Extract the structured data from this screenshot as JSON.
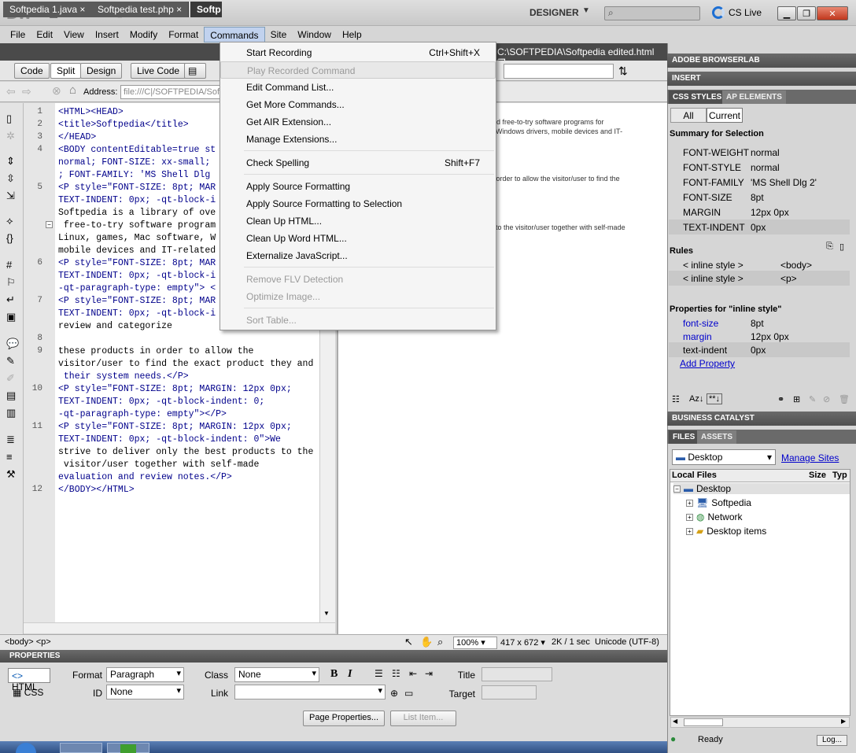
{
  "app": {
    "logo": "Dw",
    "workspace": "DESIGNER",
    "cslive": "CS Live",
    "window_buttons": [
      "▁",
      "❐",
      "✕"
    ]
  },
  "menubar": [
    "File",
    "Edit",
    "View",
    "Insert",
    "Modify",
    "Format",
    "Commands",
    "Site",
    "Window",
    "Help"
  ],
  "doc_tabs": [
    "Softpedia 1.java",
    "Softpedia test.php",
    "Softp"
  ],
  "doc_path": "C:\\SOFTPEDIA\\Softpedia edited.html",
  "view_buttons": {
    "code": "Code",
    "split": "Split",
    "design": "Design",
    "live_code": "Live Code"
  },
  "address": {
    "label": "Address:",
    "value": "file:///C|/SOFTPEDIA/Sof"
  },
  "code_lines": [
    {
      "n": "1",
      "t": "<HTML><HEAD>",
      "k": "tag"
    },
    {
      "n": "2",
      "t": "<title>Softpedia</title>",
      "k": "tag"
    },
    {
      "n": "3",
      "t": "</HEAD>",
      "k": "tag"
    },
    {
      "n": "4",
      "t": "<BODY contentEditable=true st",
      "k": "tag"
    },
    {
      "n": "",
      "t": "normal; FONT-SIZE: xx-small;",
      "k": "tag"
    },
    {
      "n": "",
      "t": "; FONT-FAMILY: 'MS Shell Dlg",
      "k": "tag"
    },
    {
      "n": "5",
      "t": "<P style=\"FONT-SIZE: 8pt; MAR",
      "k": "tag"
    },
    {
      "n": "",
      "t": "TEXT-INDENT: 0px; -qt-block-i",
      "k": "tag"
    },
    {
      "n": "",
      "t": "Softpedia is a library of ove",
      "k": "txt"
    },
    {
      "n": "",
      "t": " free-to-try software program",
      "k": "txt"
    },
    {
      "n": "",
      "t": "Linux, games, Mac software, W",
      "k": "txt"
    },
    {
      "n": "",
      "t": "mobile devices and IT-related",
      "k": "txt"
    },
    {
      "n": "6",
      "t": "<P style=\"FONT-SIZE: 8pt; MAR",
      "k": "tag"
    },
    {
      "n": "",
      "t": "TEXT-INDENT: 0px; -qt-block-i",
      "k": "tag"
    },
    {
      "n": "",
      "t": "-qt-paragraph-type: empty\"> <",
      "k": "tag"
    },
    {
      "n": "7",
      "t": "<P style=\"FONT-SIZE: 8pt; MAR",
      "k": "tag"
    },
    {
      "n": "",
      "t": "TEXT-INDENT: 0px; -qt-block-i",
      "k": "tag"
    },
    {
      "n": "",
      "t": "review and categorize",
      "k": "txt"
    },
    {
      "n": "8",
      "t": "",
      "k": "txt"
    },
    {
      "n": "9",
      "t": "these products in order to allow the",
      "k": "txt"
    },
    {
      "n": "",
      "t": "visitor/user to find the exact product they and",
      "k": "txt"
    },
    {
      "n": "",
      "t": " their system needs.</P>",
      "k": "tag"
    },
    {
      "n": "10",
      "t": "<P style=\"FONT-SIZE: 8pt; MARGIN: 12px 0px;",
      "k": "tag"
    },
    {
      "n": "",
      "t": "TEXT-INDENT: 0px; -qt-block-indent: 0;",
      "k": "tag"
    },
    {
      "n": "",
      "t": "-qt-paragraph-type: empty\"></P>",
      "k": "tag"
    },
    {
      "n": "11",
      "t": "<P style=\"FONT-SIZE: 8pt; MARGIN: 12px 0px;",
      "k": "tag"
    },
    {
      "n": "",
      "t": "TEXT-INDENT: 0px; -qt-block-indent: 0\">We",
      "k": "tag"
    },
    {
      "n": "",
      "t": "strive to deliver only the best products to the",
      "k": "txt"
    },
    {
      "n": "",
      "t": " visitor/user together with self-made",
      "k": "txt"
    },
    {
      "n": "",
      "t": "evaluation and review notes.</P>",
      "k": "tag"
    },
    {
      "n": "12",
      "t": "</BODY></HTML>",
      "k": "tag"
    }
  ],
  "design_text": [
    "nd free-to-try software programs for",
    "Windows drivers, mobile devices and IT-",
    "n order to allow the visitor/user to find the",
    "to the visitor/user together with self-made"
  ],
  "commands_menu": [
    {
      "label": "Start Recording",
      "shortcut": "Ctrl+Shift+X",
      "disabled": false
    },
    {
      "label": "Play Recorded Command",
      "shortcut": "",
      "disabled": true
    },
    {
      "label": "Edit Command List...",
      "shortcut": "",
      "disabled": false
    },
    {
      "label": "Get More Commands...",
      "shortcut": "",
      "disabled": false
    },
    {
      "label": "Get AIR Extension...",
      "shortcut": "",
      "disabled": false
    },
    {
      "label": "Manage Extensions...",
      "shortcut": "",
      "disabled": false
    },
    {
      "label": "Check Spelling",
      "shortcut": "Shift+F7",
      "disabled": false
    },
    {
      "label": "Apply Source Formatting",
      "shortcut": "",
      "disabled": false
    },
    {
      "label": "Apply Source Formatting to Selection",
      "shortcut": "",
      "disabled": false
    },
    {
      "label": "Clean Up HTML...",
      "shortcut": "",
      "disabled": false
    },
    {
      "label": "Clean Up Word HTML...",
      "shortcut": "",
      "disabled": false
    },
    {
      "label": "Externalize JavaScript...",
      "shortcut": "",
      "disabled": false
    },
    {
      "label": "Remove FLV Detection",
      "shortcut": "",
      "disabled": true
    },
    {
      "label": "Optimize Image...",
      "shortcut": "",
      "disabled": true
    },
    {
      "label": "Sort Table...",
      "shortcut": "",
      "disabled": true
    }
  ],
  "status": {
    "tags": "<body> <p>",
    "zoom": "100%",
    "size": "417 x 672",
    "download": "2K / 1 sec",
    "encoding": "Unicode (UTF-8)"
  },
  "properties": {
    "header": "PROPERTIES",
    "html": "HTML",
    "css": "CSS",
    "format_label": "Format",
    "format_value": "Paragraph",
    "class_label": "Class",
    "class_value": "None",
    "id_label": "ID",
    "id_value": "None",
    "link_label": "Link",
    "title_label": "Title",
    "target_label": "Target",
    "page_props": "Page Properties...",
    "list_item": "List Item...",
    "bold": "B",
    "italic": "I"
  },
  "panels": {
    "browserlab": "ADOBE BROWSERLAB",
    "insert": "INSERT",
    "css_styles": "CSS STYLES",
    "ap_elements": "AP ELEMENTS",
    "all": "All",
    "current": "Current",
    "summary_title": "Summary for Selection",
    "summary": [
      {
        "k": "FONT-WEIGHT",
        "v": "normal"
      },
      {
        "k": "FONT-STYLE",
        "v": "normal"
      },
      {
        "k": "FONT-FAMILY",
        "v": "'MS Shell Dlg 2'"
      },
      {
        "k": "FONT-SIZE",
        "v": "8pt"
      },
      {
        "k": "MARGIN",
        "v": "12px 0px"
      },
      {
        "k": "TEXT-INDENT",
        "v": "0px"
      }
    ],
    "rules_title": "Rules",
    "rules": [
      {
        "k": "< inline style >",
        "v": "<body>"
      },
      {
        "k": "< inline style >",
        "v": "<p>"
      }
    ],
    "props_title": "Properties for \"inline style\"",
    "props": [
      {
        "k": "font-size",
        "v": "8pt"
      },
      {
        "k": "margin",
        "v": "12px 0px"
      },
      {
        "k": "text-indent",
        "v": "0px"
      }
    ],
    "add_property": "Add Property",
    "business_catalyst": "BUSINESS CATALYST",
    "files": "FILES",
    "assets": "ASSETS",
    "site_select": "Desktop",
    "manage_sites": "Manage Sites",
    "local_files": "Local Files",
    "size": "Size",
    "type": "Typ",
    "tree": [
      "Desktop",
      "Softpedia",
      "Network",
      "Desktop items"
    ],
    "ready": "Ready",
    "log": "Log..."
  }
}
